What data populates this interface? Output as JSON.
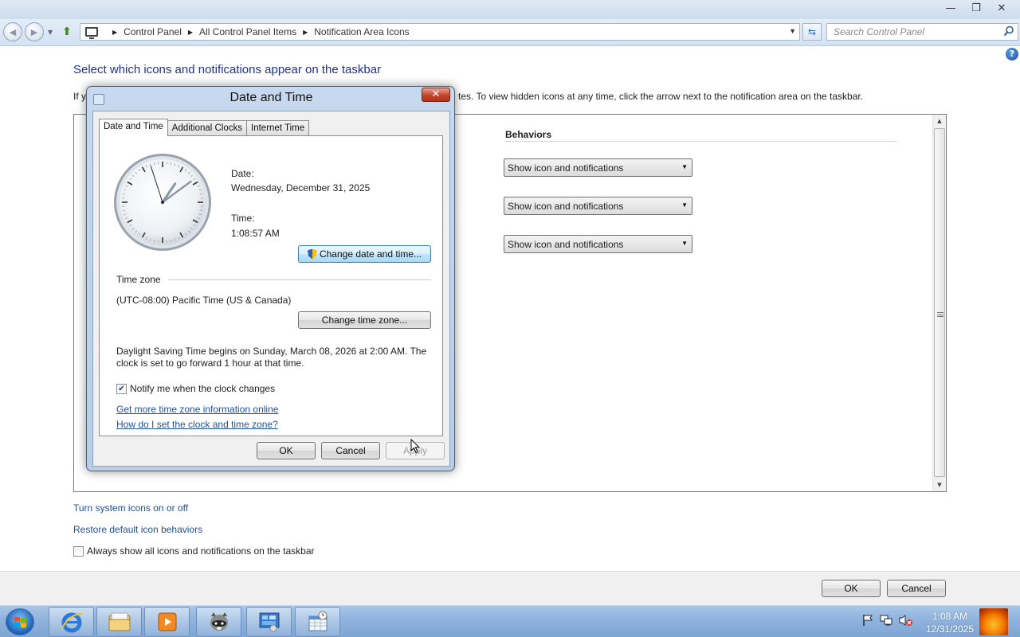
{
  "window": {
    "minimize_glyph": "—",
    "maximize_glyph": "❐",
    "close_glyph": "✕"
  },
  "address": {
    "crumbs": [
      "Control Panel",
      "All Control Panel Items",
      "Notification Area Icons"
    ],
    "search_placeholder": "Search Control Panel"
  },
  "page": {
    "title": "Select which icons and notifications appear on the taskbar",
    "intro_visible_left": "If y",
    "intro_visible_right": "tes. To view hidden icons at any time, click the arrow next to the notification area on the taskbar.",
    "behaviors_header": "Behaviors",
    "behavior_values": [
      "Show icon and notifications",
      "Show icon and notifications",
      "Show icon and notifications"
    ],
    "links": {
      "system_icons": "Turn system icons on or off",
      "restore_defaults": "Restore default icon behaviors"
    },
    "always_show_label": "Always show all icons and notifications on the taskbar",
    "always_show_checked": false,
    "ok_label": "OK",
    "cancel_label": "Cancel"
  },
  "dialog": {
    "title": "Date and Time",
    "tabs": [
      "Date and Time",
      "Additional Clocks",
      "Internet Time"
    ],
    "active_tab": "Date and Time",
    "date_label": "Date:",
    "date_value": "Wednesday, December 31, 2025",
    "time_label": "Time:",
    "time_value": "1:08:57 AM",
    "change_datetime_button": "Change date and time...",
    "timezone_heading": "Time zone",
    "timezone_value": "(UTC-08:00) Pacific Time (US & Canada)",
    "change_timezone_button": "Change time zone...",
    "dst_line1": "Daylight Saving Time begins on Sunday, March 08, 2026 at 2:00 AM. The",
    "dst_line2": "clock is set to go forward 1 hour at that time.",
    "notify_label": "Notify me when the clock changes",
    "notify_checked": true,
    "link_more_info": "Get more time zone information online",
    "link_how_to": "How do I set the clock and time zone?",
    "ok_label": "OK",
    "cancel_label": "Cancel",
    "apply_label": "Apply",
    "apply_enabled": false,
    "analog_clock": {
      "hours": 1,
      "minutes": 8,
      "seconds": 57
    }
  },
  "taskbar": {
    "pinned": [
      "internet-explorer-icon",
      "file-explorer-icon",
      "media-player-icon",
      "raccoon-app-icon",
      "control-panel-icon",
      "calendar-tool-icon"
    ],
    "tray_icons": [
      "action-center-flag-icon",
      "network-icon",
      "volume-muted-icon"
    ],
    "clock_time": "1:08 AM",
    "clock_date": "12/31/2025"
  },
  "colors": {
    "link": "#1e4f9c",
    "title": "#1e3287",
    "dialog_frame": "#c7d9ee",
    "taskbar": "#8fb3dd"
  }
}
